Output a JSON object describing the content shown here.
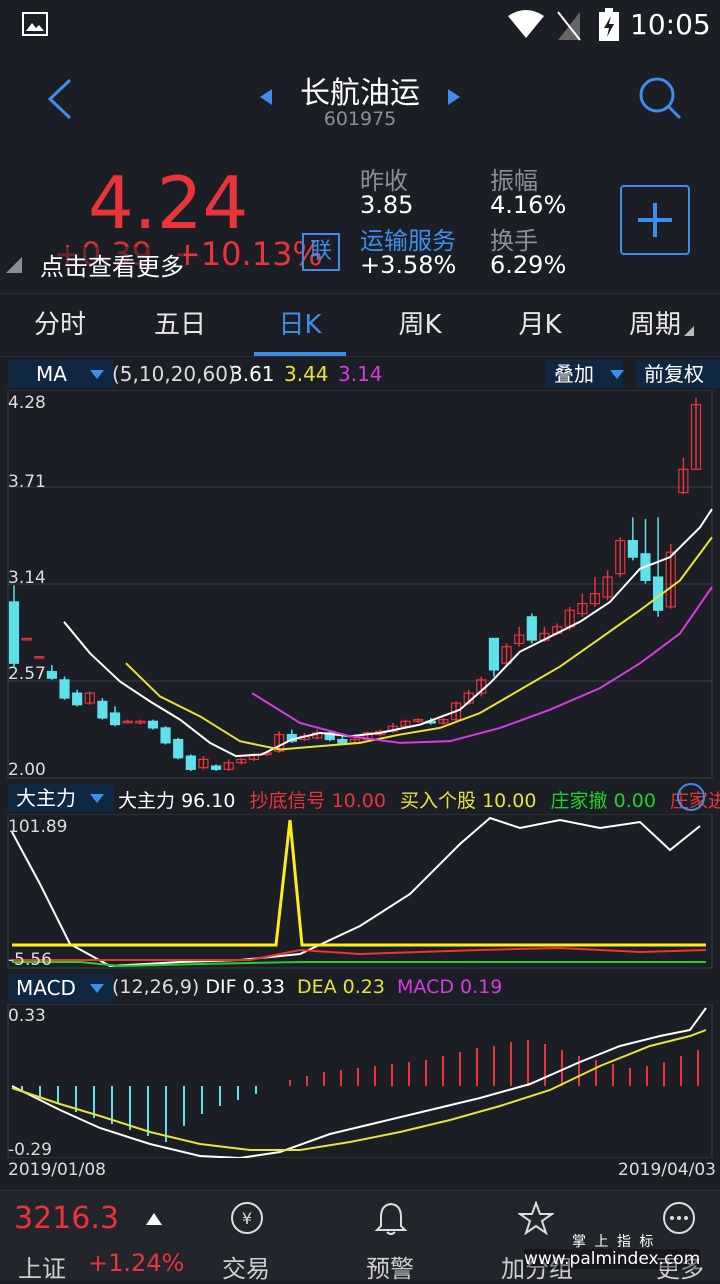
{
  "status": {
    "time": "10:05"
  },
  "header": {
    "title": "长航油运",
    "code": "601975"
  },
  "quote": {
    "price": "4.24",
    "change": "+0.39",
    "change_pct": "+10.13%",
    "lian_label": "联",
    "overlay_hint": "点击查看更多",
    "stats": [
      {
        "label": "昨收",
        "value": "3.85"
      },
      {
        "label": "振幅",
        "value": "4.16%"
      },
      {
        "label": "运输服务",
        "value": "+3.58%"
      },
      {
        "label": "换手",
        "value": "6.29%"
      }
    ],
    "add_label": "+"
  },
  "tabs": [
    {
      "label": "分时"
    },
    {
      "label": "五日"
    },
    {
      "label": "日K"
    },
    {
      "label": "周K"
    },
    {
      "label": "月K"
    },
    {
      "label": "周期"
    }
  ],
  "ma_bar": {
    "indicator": "MA",
    "params": "(5,10,20,60)",
    "v1": "3.61",
    "v2": "3.44",
    "v3": "3.14",
    "overlay_label": "叠加",
    "adjust_label": "前复权"
  },
  "price_axis": [
    "4.28",
    "3.71",
    "3.14",
    "2.57",
    "2.00"
  ],
  "dzl_bar": {
    "indicator": "大主力",
    "name": "大主力",
    "name_value": "96.10",
    "s1": "抄底信号",
    "s1v": "10.00",
    "s2": "买入个股",
    "s2v": "10.00",
    "s3": "庄家撤",
    "s3v": "0.00",
    "s4": "庄家进"
  },
  "dzl_axis": [
    "101.89",
    "-5.56"
  ],
  "macd_bar": {
    "indicator": "MACD",
    "params": "(12,26,9)",
    "dif_label": "DIF",
    "dif": "0.33",
    "dea_label": "DEA",
    "dea": "0.23",
    "macd_label": "MACD",
    "macd": "0.19"
  },
  "macd_axis": [
    "0.33",
    "-0.29"
  ],
  "dates": {
    "start": "2019/01/08",
    "end": "2019/04/03"
  },
  "index": {
    "value": "3216.3",
    "name": "上证",
    "pct": "+1.24%"
  },
  "bottom_nav": [
    {
      "label": "交易"
    },
    {
      "label": "预警"
    },
    {
      "label": "加分组"
    },
    {
      "label": "更多"
    }
  ],
  "watermark": {
    "top": "掌 上 指 标",
    "url": "www.palmindex.com"
  },
  "colors": {
    "up": "#e8343a",
    "down": "#5fe0ea",
    "accent": "#3d8eea",
    "ma5": "#ffffff",
    "ma10": "#e8e33a",
    "ma20": "#d63ce0",
    "green": "#1fd12a"
  }
}
